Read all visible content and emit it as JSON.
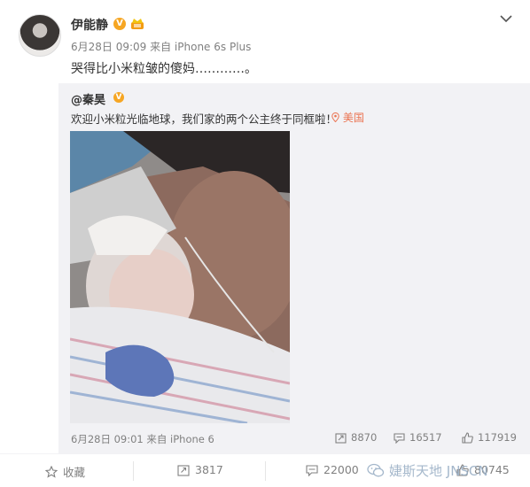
{
  "post": {
    "author": "伊能静",
    "verified_badge": "V",
    "meta": "6月28日 09:09 来自 iPhone 6s Plus",
    "text": "哭得比小米粒皱的傻妈…………。"
  },
  "repost": {
    "author": "@秦昊",
    "verified_badge": "V",
    "text": "欢迎小米粒光临地球，我们家的两个公主终于同框啦！",
    "location": "美国",
    "meta": "6月28日 09:01 来自 iPhone 6",
    "reposts": "8870",
    "comments": "16517",
    "likes": "117919"
  },
  "actions": {
    "favorite": "收藏",
    "repost_count": "3817",
    "comment_count": "22000",
    "like_count": "80745"
  },
  "watermark": "婕斯天地 JNSCN",
  "colors": {
    "accent": "#eb7350",
    "verified": "#f6a623",
    "muted": "#808080",
    "repost_bg": "#f2f2f5"
  }
}
